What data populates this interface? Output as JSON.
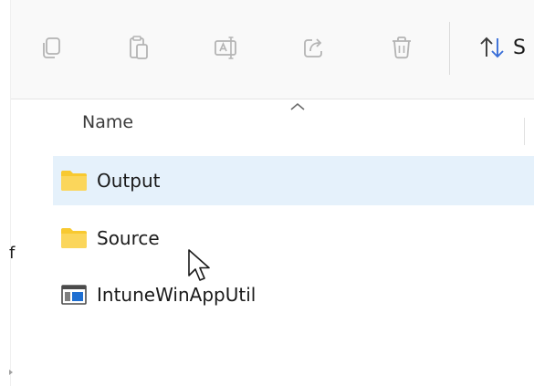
{
  "nav": {
    "partial_letter": "f"
  },
  "toolbar": {
    "buttons": [
      {
        "name": "copy-icon"
      },
      {
        "name": "paste-icon"
      },
      {
        "name": "rename-icon"
      },
      {
        "name": "share-icon"
      },
      {
        "name": "delete-icon"
      }
    ],
    "sort_label": "S"
  },
  "columns": {
    "name_label": "Name"
  },
  "files": [
    {
      "label": "Output",
      "type": "folder",
      "selected": true
    },
    {
      "label": "Source",
      "type": "folder",
      "selected": false
    },
    {
      "label": "IntuneWinAppUtil",
      "type": "application",
      "selected": false
    }
  ],
  "colors": {
    "selection": "#e5f1fb",
    "folder": "#f8c930",
    "toolbar_bg": "#f9f9f9",
    "icon_disabled": "#b4b4b4"
  }
}
